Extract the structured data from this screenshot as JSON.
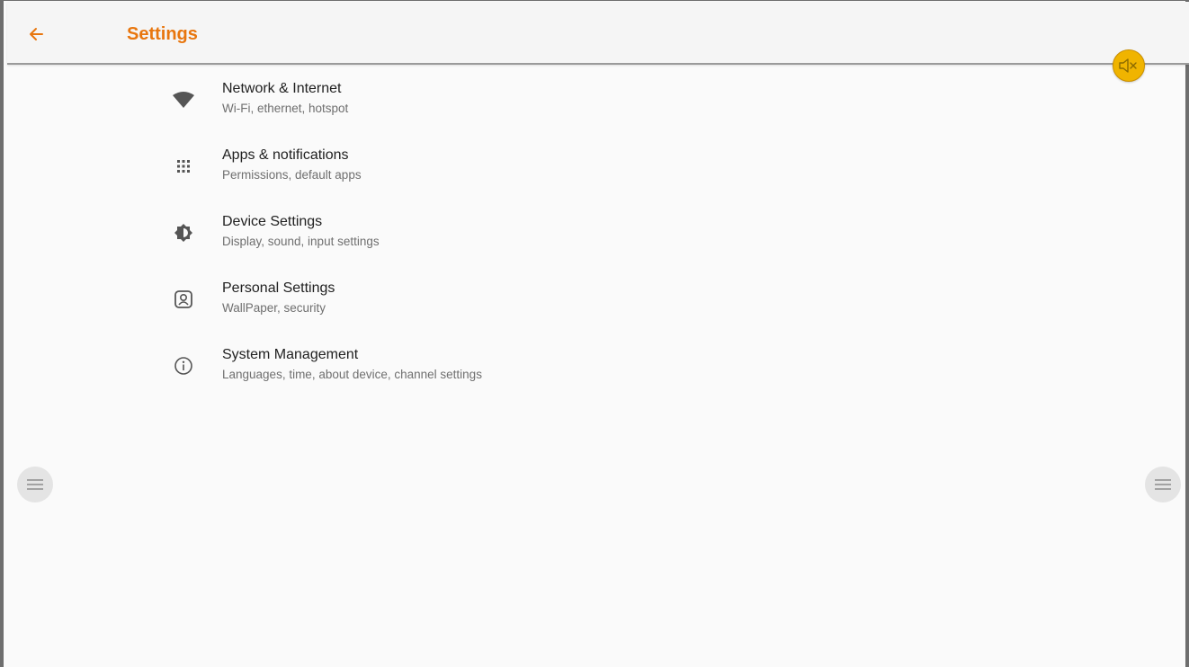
{
  "app_bar": {
    "title": "Settings",
    "back_icon": "arrow-back-icon",
    "accent_color": "#e8760e"
  },
  "mute_button": {
    "icon": "volume-mute-icon",
    "color": "#f0b400"
  },
  "items": [
    {
      "icon": "wifi-icon",
      "label": "Network & Internet",
      "subtitle": "Wi-Fi, ethernet, hotspot"
    },
    {
      "icon": "apps-grid-icon",
      "label": "Apps & notifications",
      "subtitle": "Permissions, default apps"
    },
    {
      "icon": "brightness-icon",
      "label": "Device Settings",
      "subtitle": "Display, sound, input settings"
    },
    {
      "icon": "personal-icon",
      "label": "Personal Settings",
      "subtitle": "WallPaper, security"
    },
    {
      "icon": "info-icon",
      "label": "System Management",
      "subtitle": "Languages, time, about device, channel settings"
    }
  ],
  "side_buttons": {
    "left_icon": "menu-icon",
    "right_icon": "menu-icon"
  }
}
